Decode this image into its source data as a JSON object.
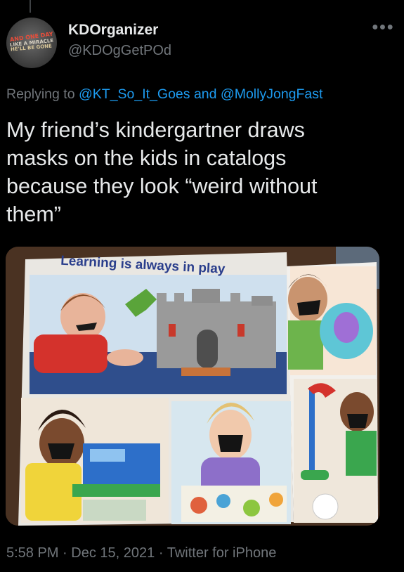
{
  "tweet": {
    "avatar": {
      "line1": "AND ONE DAY",
      "line2": "LIKE A MIRACLE",
      "line3": "HE'LL BE GONE"
    },
    "author_name": "KDOrganizer",
    "author_handle": "@KDOgGetPOd",
    "more_icon": "more-horizontal-icon",
    "replying_prefix": "Replying to",
    "reply_to_1": "@KT_So_It_Goes",
    "reply_and": "and",
    "reply_to_2": "@MollyJongFast",
    "text_lines": [
      "My friend’s kindergartner draws",
      "masks on the kids in catalogs",
      "because they look “weird without",
      "them”"
    ],
    "photo": {
      "catalog_headline": "Learning is always in play"
    },
    "time": "5:58 PM",
    "separator": "·",
    "date": "Dec 15, 2021",
    "source": "Twitter for iPhone"
  },
  "colors": {
    "background": "#000000",
    "text": "#e7e9ea",
    "secondary": "#71767b",
    "link": "#1d9bf0"
  }
}
